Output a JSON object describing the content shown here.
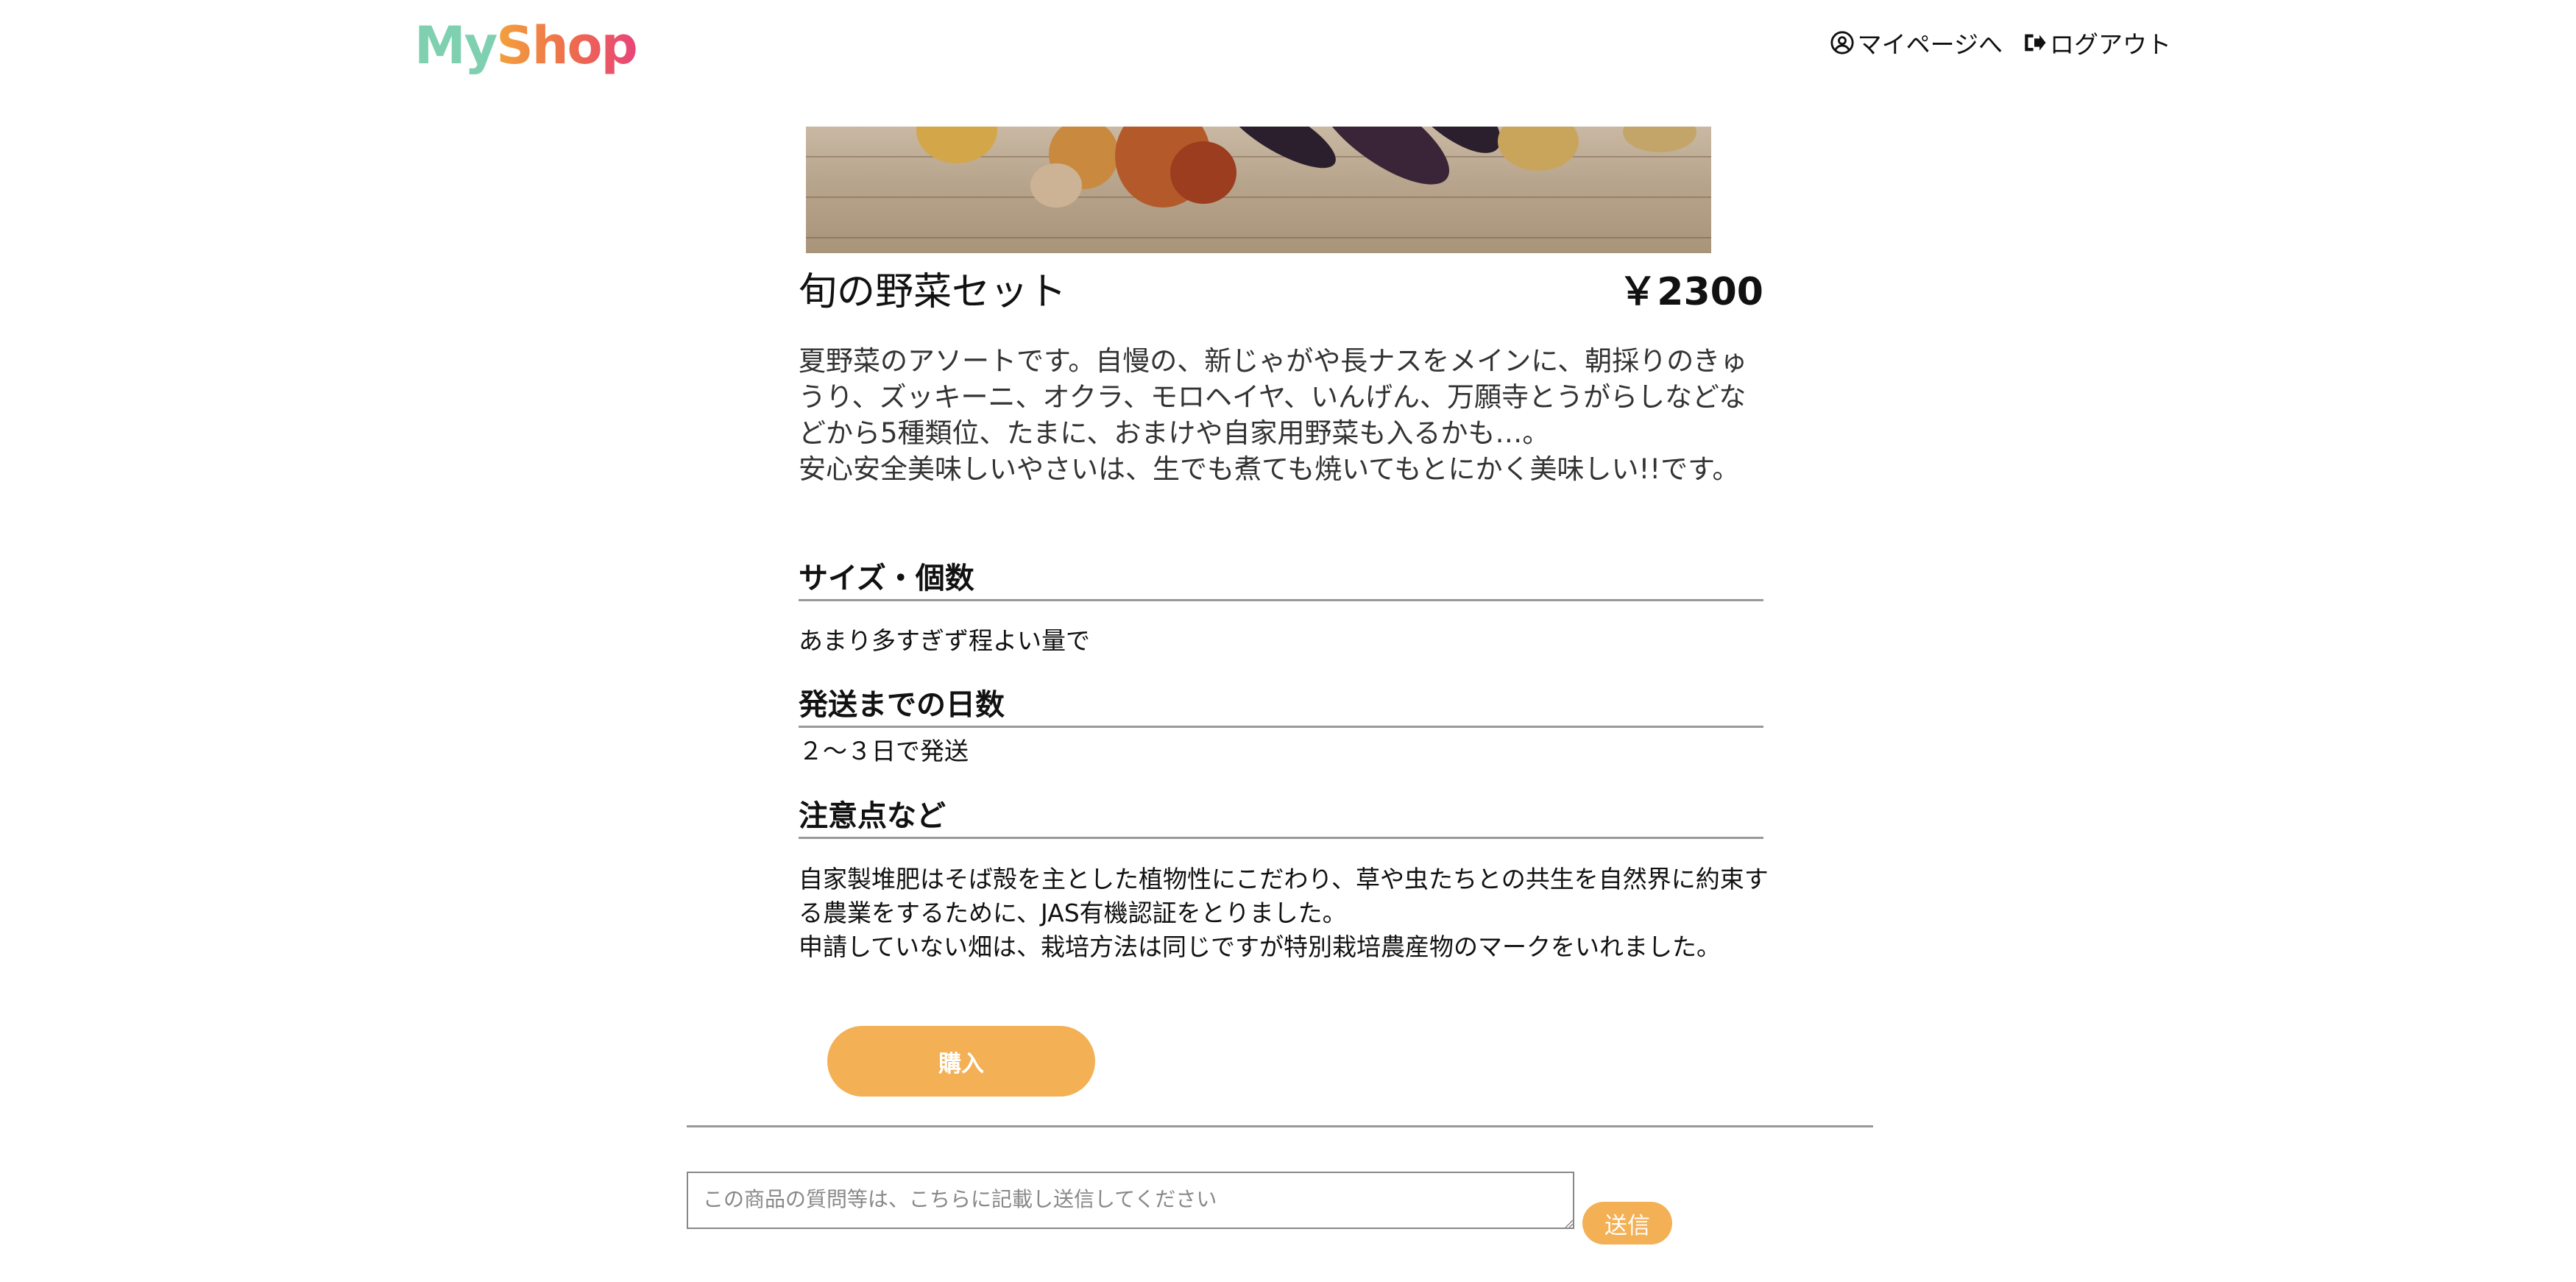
{
  "header": {
    "logo_my": "My",
    "logo_shop": "Shop",
    "mypage_label": "マイページへ",
    "logout_label": "ログアウト",
    "mypage_icon": "user-circle-icon",
    "logout_icon": "sign-out-icon"
  },
  "product": {
    "title": "旬の野菜セット",
    "price": "￥2300",
    "description": [
      "夏野菜のアソートです。自慢の、新じゃがや長ナスをメインに、朝採りのきゅうり、ズッキーニ、オクラ、モロヘイヤ、いんげん、万願寺とうがらしなどなどから5種類位、たまに、おまけや自家用野菜も入るかも…。",
      "安心安全美味しいやさいは、生でも煮ても焼いてもとにかく美味しい!!です。"
    ]
  },
  "sections": [
    {
      "heading": "サイズ・個数",
      "text": [
        "あまり多すぎず程よい量で"
      ]
    },
    {
      "heading": "発送までの日数",
      "text": [
        "２～３日で発送"
      ]
    },
    {
      "heading": "注意点など",
      "text": [
        "自家製堆肥はそば殻を主とした植物性にこだわり、草や虫たちとの共生を自然界に約束する農業をするために、JAS有機認証をとりました。",
        "申請していない畑は、栽培方法は同じですが特別栽培農産物のマークをいれました。"
      ]
    }
  ],
  "actions": {
    "buy_label": "購入",
    "comment_placeholder": "この商品の質問等は、こちらに記載し送信してください",
    "send_label": "送信"
  },
  "colors": {
    "accent": "#f3b054",
    "logo_my": "#7fd0b0",
    "logo_shop_start": "#f3a23b",
    "logo_shop_end": "#e8457a"
  }
}
